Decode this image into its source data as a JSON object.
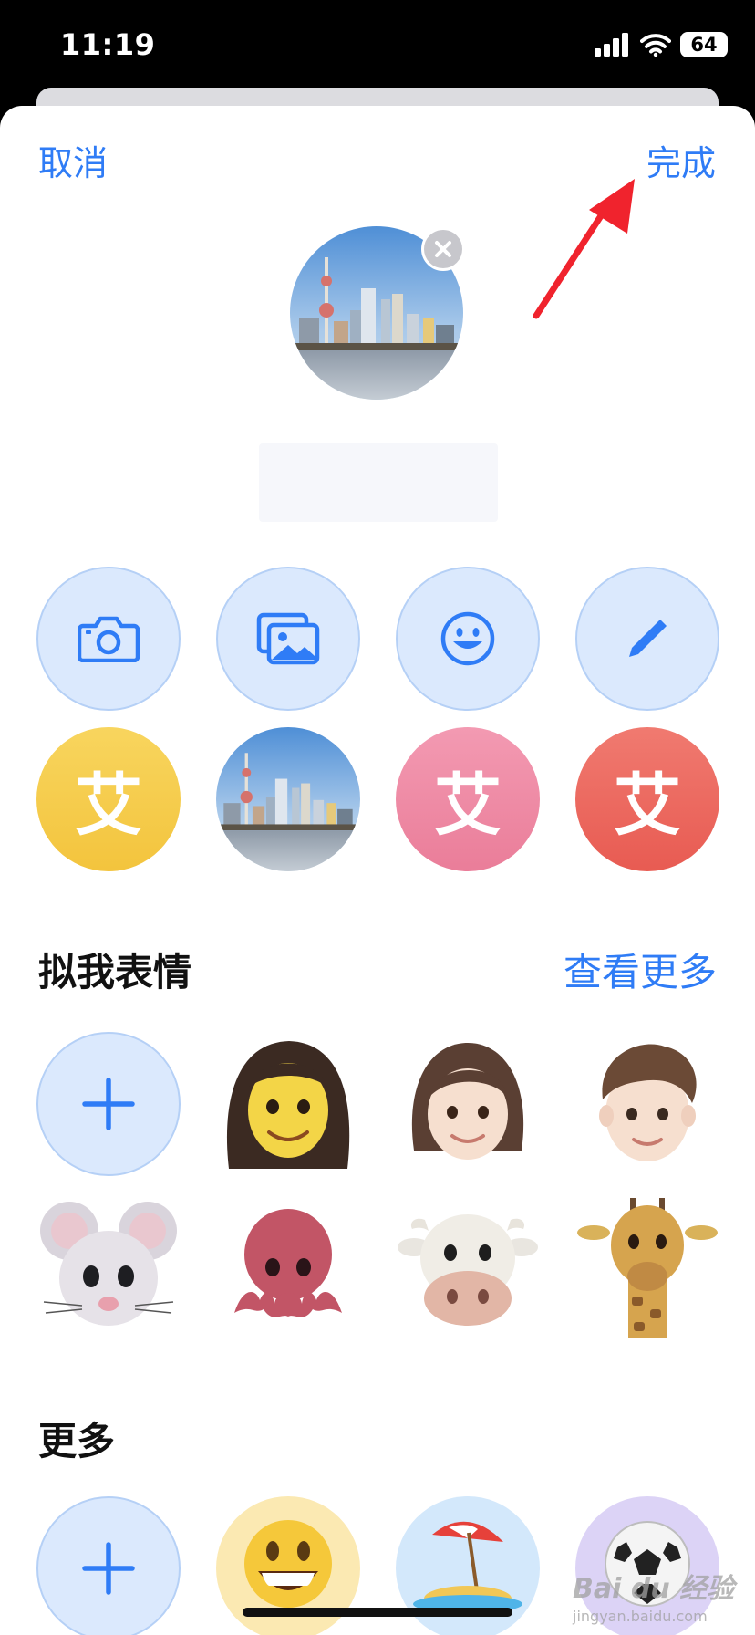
{
  "status_bar": {
    "time": "11:19",
    "battery": "64"
  },
  "nav": {
    "cancel": "取消",
    "done": "完成"
  },
  "options": [
    {
      "name": "camera-icon"
    },
    {
      "name": "photos-icon"
    },
    {
      "name": "emoji-icon"
    },
    {
      "name": "pencil-icon"
    }
  ],
  "letter_avatars": [
    {
      "text": "艾",
      "color": "#f6cb4b"
    },
    {
      "text": "艾",
      "color": "#ef8aa4"
    },
    {
      "text": "艾",
      "color": "#ec6860"
    }
  ],
  "memoji_section": {
    "title": "拟我表情",
    "see_more": "查看更多"
  },
  "memoji_items": [
    "memoji-girl-long-hair",
    "memoji-girl-bob",
    "memoji-boy",
    "mouse-memoji",
    "octopus-memoji",
    "cow-memoji",
    "giraffe-memoji"
  ],
  "more_section": {
    "title": "更多"
  },
  "more_items": [
    "grinning-emoji",
    "beach-umbrella-emoji",
    "soccer-ball-emoji"
  ],
  "watermark": {
    "line1": "Bai du 经验",
    "line2": "jingyan.baidu.com"
  },
  "colors": {
    "accent": "#2f7cf6",
    "option_bg": "#dbe9fd"
  }
}
